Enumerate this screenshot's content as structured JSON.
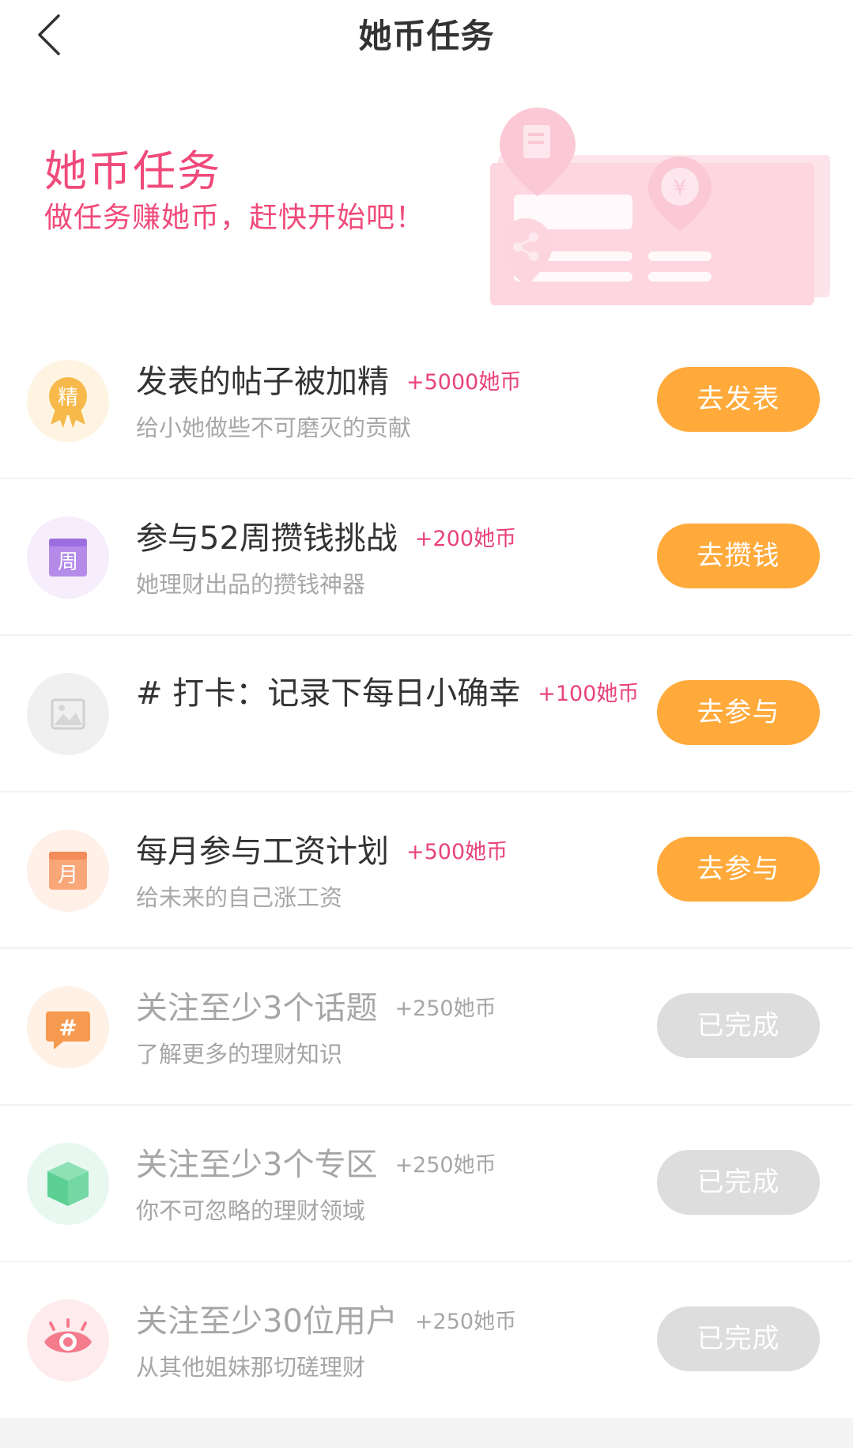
{
  "nav": {
    "title": "她币任务"
  },
  "banner": {
    "title": "她币任务",
    "subtitle": "做任务赚她币，赶快开始吧！"
  },
  "tasks": [
    {
      "icon": "jing-medal-icon",
      "icon_label": "精",
      "title": "发表的帖子被加精",
      "reward": "+5000她币",
      "desc": "给小她做些不可磨灭的贡献",
      "button": "去发表",
      "status": "active"
    },
    {
      "icon": "zhou-calendar-icon",
      "icon_label": "周",
      "title": "参与52周攒钱挑战",
      "reward": "+200她币",
      "desc": "她理财出品的攒钱神器",
      "button": "去攒钱",
      "status": "active"
    },
    {
      "icon": "image-placeholder-icon",
      "title": "# 打卡：记录下每日小确幸",
      "reward": "+100她币",
      "desc": "",
      "button": "去参与",
      "status": "active"
    },
    {
      "icon": "yue-calendar-icon",
      "icon_label": "月",
      "title": "每月参与工资计划",
      "reward": "+500她币",
      "desc": "给未来的自己涨工资",
      "button": "去参与",
      "status": "active"
    },
    {
      "icon": "hashtag-bubble-icon",
      "title": "关注至少3个话题",
      "reward": "+250她币",
      "desc": "了解更多的理财知识",
      "button": "已完成",
      "status": "done"
    },
    {
      "icon": "cube-icon",
      "title": "关注至少3个专区",
      "reward": "+250她币",
      "desc": "你不可忽略的理财领域",
      "button": "已完成",
      "status": "done"
    },
    {
      "icon": "eye-user-icon",
      "title": "关注至少30位用户",
      "reward": "+250她币",
      "desc": "从其他姐妹那切磋理财",
      "button": "已完成",
      "status": "done"
    }
  ],
  "colors": {
    "accent_pink": "#f04a7a",
    "button_orange": "#ffaa3b",
    "button_done": "#dddddd"
  }
}
